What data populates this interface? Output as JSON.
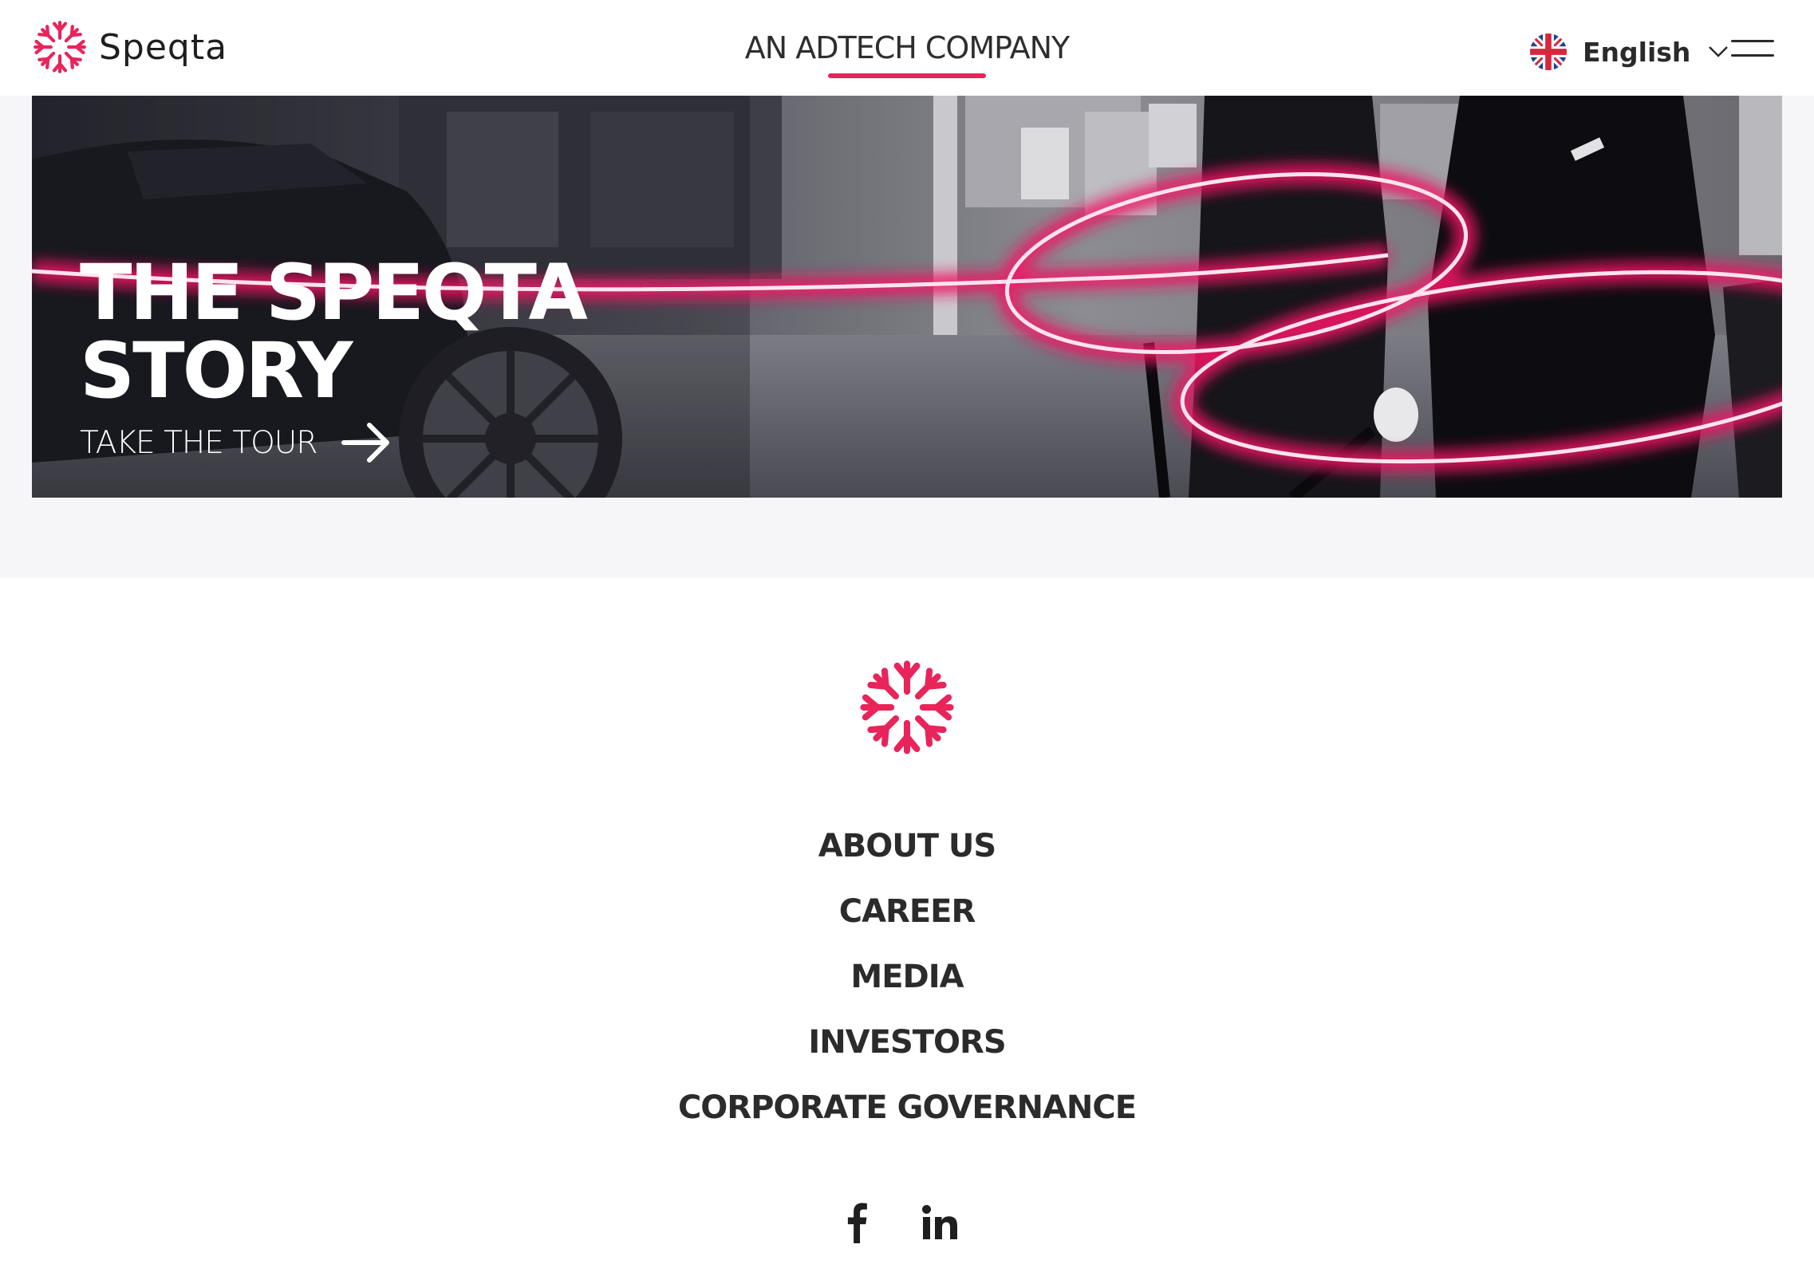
{
  "header": {
    "brand": "Speqta",
    "tagline": "AN ADTECH COMPANY",
    "language": {
      "label": "English",
      "flag_icon": "uk-flag-icon"
    },
    "menu_icon": "hamburger-menu-icon"
  },
  "banner": {
    "title_line1": "THE SPEQTA",
    "title_line2": "STORY",
    "cta_label": "TAKE THE TOUR",
    "cta_icon": "arrow-right-icon"
  },
  "footer": {
    "nav": [
      {
        "label": "ABOUT US"
      },
      {
        "label": "CAREER"
      },
      {
        "label": "MEDIA"
      },
      {
        "label": "INVESTORS"
      },
      {
        "label": "CORPORATE GOVERNANCE"
      }
    ],
    "social": [
      {
        "name": "facebook-icon"
      },
      {
        "name": "linkedin-icon"
      }
    ]
  },
  "colors": {
    "accent": "#e8245a",
    "text": "#2b2b2b",
    "band": "#f6f6f8"
  }
}
